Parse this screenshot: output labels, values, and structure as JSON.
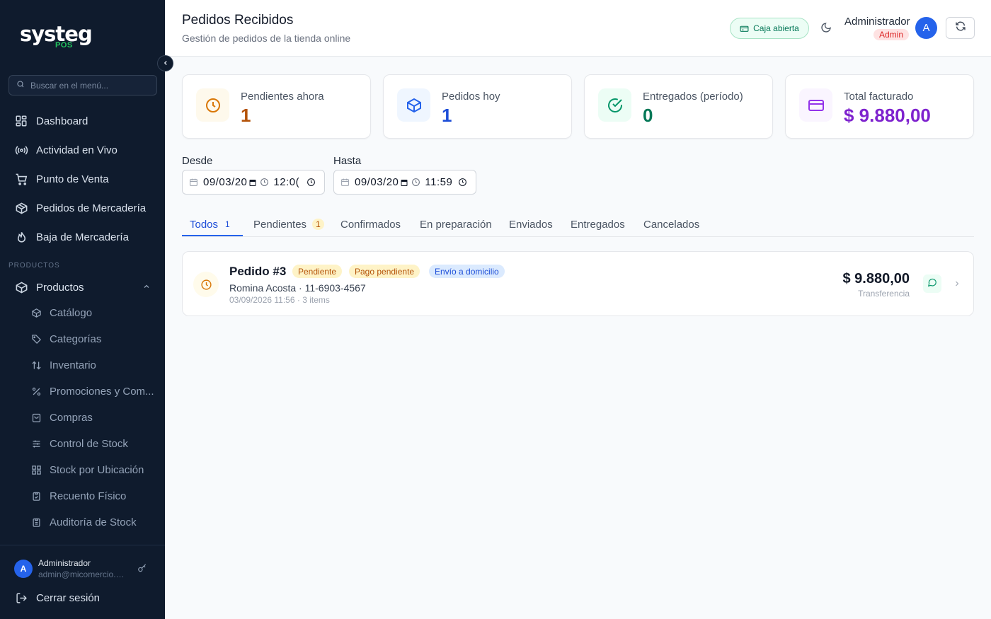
{
  "brand": {
    "name": "systeg",
    "sub": "POS",
    "accent": "#22c55e"
  },
  "sidebar": {
    "search_placeholder": "Buscar en el menú...",
    "items": [
      {
        "label": "Dashboard",
        "icon": "grid-icon"
      },
      {
        "label": "Actividad en Vivo",
        "icon": "broadcast-icon"
      },
      {
        "label": "Punto de Venta",
        "icon": "cart-icon"
      },
      {
        "label": "Pedidos de Mercadería",
        "icon": "package-icon"
      },
      {
        "label": "Baja de Mercadería",
        "icon": "flame-icon"
      }
    ],
    "section_label": "PRODUCTOS",
    "group": {
      "label": "Productos",
      "icon": "box-icon"
    },
    "sub_items": [
      {
        "label": "Catálogo",
        "icon": "box-icon"
      },
      {
        "label": "Categorías",
        "icon": "tag-icon"
      },
      {
        "label": "Inventario",
        "icon": "arrows-updown-icon"
      },
      {
        "label": "Promociones y Com...",
        "icon": "percent-icon"
      },
      {
        "label": "Compras",
        "icon": "bag-icon"
      },
      {
        "label": "Control de Stock",
        "icon": "sliders-icon"
      },
      {
        "label": "Stock por Ubicación",
        "icon": "grid-icon"
      },
      {
        "label": "Recuento Físico",
        "icon": "clipboard-check-icon"
      },
      {
        "label": "Auditoría de Stock",
        "icon": "clipboard-list-icon"
      }
    ],
    "user": {
      "initial": "A",
      "name": "Administrador",
      "email": "admin@micomercio.com"
    },
    "logout_label": "Cerrar sesión"
  },
  "header": {
    "title": "Pedidos Recibidos",
    "subtitle": "Gestión de pedidos de la tienda online",
    "cash_status": "Caja abierta",
    "user_name": "Administrador",
    "user_role": "Admin",
    "user_initial": "A"
  },
  "stats": [
    {
      "label": "Pendientes ahora",
      "value": "1",
      "color": "#b45309",
      "bg": "#fef9ec",
      "icon": "clock-icon"
    },
    {
      "label": "Pedidos hoy",
      "value": "1",
      "color": "#1d4ed8",
      "bg": "#eff6ff",
      "icon": "package-icon"
    },
    {
      "label": "Entregados (período)",
      "value": "0",
      "color": "#047857",
      "bg": "#ecfdf5",
      "icon": "check-circle-icon"
    },
    {
      "label": "Total facturado",
      "value": "$ 9.880,00",
      "color": "#7e22ce",
      "bg": "#faf5ff",
      "icon": "credit-card-icon"
    }
  ],
  "filters": {
    "from_label": "Desde",
    "from_value": "09/03/20",
    "from_time": "12:0(",
    "to_label": "Hasta",
    "to_value": "09/03/20",
    "to_time": "11:59"
  },
  "tabs": [
    {
      "label": "Todos",
      "count": "1"
    },
    {
      "label": "Pendientes",
      "count": "1"
    },
    {
      "label": "Confirmados"
    },
    {
      "label": "En preparación"
    },
    {
      "label": "Enviados"
    },
    {
      "label": "Entregados"
    },
    {
      "label": "Cancelados"
    }
  ],
  "orders": [
    {
      "title": "Pedido #3",
      "badges": [
        "Pendiente",
        "Pago pendiente",
        "Envío a domicilio"
      ],
      "customer": "Romina Acosta · 11-6903-4567",
      "meta": "03/09/2026 11:56 · 3 items",
      "amount": "$ 9.880,00",
      "method": "Transferencia"
    }
  ]
}
